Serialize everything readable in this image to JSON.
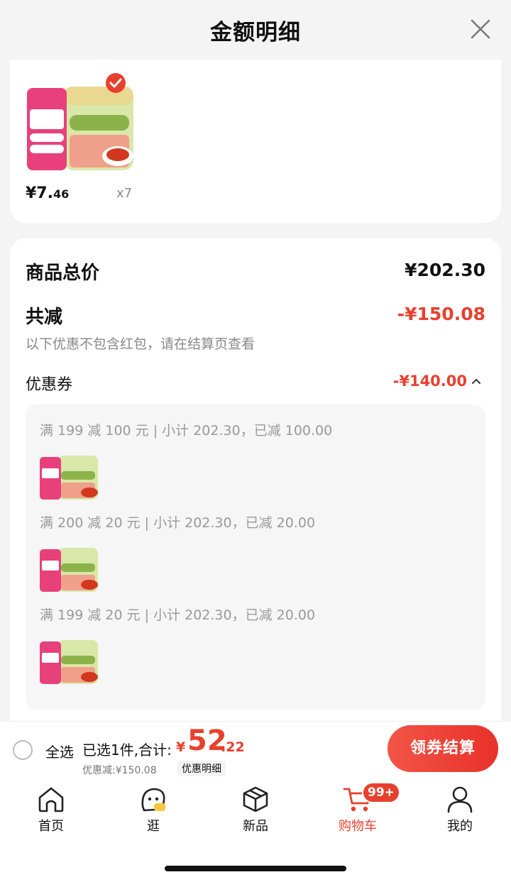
{
  "header": {
    "title": "金额明细"
  },
  "product": {
    "price_int": "¥7.",
    "price_dec": "46",
    "quantity": "x7"
  },
  "summary": {
    "total_label": "商品总价",
    "total_value": "¥202.30",
    "reduce_label": "共减",
    "reduce_value": "-¥150.08",
    "note": "以下优惠不包含红包，请在结算页查看",
    "coupon_label": "优惠券",
    "coupon_value": "-¥140.00",
    "coupons": [
      {
        "text": "满 199 减 100 元 | 小计 202.30，已减 100.00"
      },
      {
        "text": "满 200 减 20 元 | 小计 202.30，已减 20.00"
      },
      {
        "text": "满 199 减 20 元 | 小计 202.30，已减 20.00"
      }
    ]
  },
  "bottom_bar": {
    "select_all": "全选",
    "selected_text": "已选1件,合计:",
    "currency": "¥",
    "pay_int": "52",
    "pay_dec": ".22",
    "discount_text": "优惠减:¥150.08",
    "detail_chip": "优惠明细",
    "checkout": "领券结算"
  },
  "tabs": [
    {
      "label": "首页",
      "icon": "home-icon"
    },
    {
      "label": "逛",
      "icon": "explore-icon"
    },
    {
      "label": "新品",
      "icon": "box-icon"
    },
    {
      "label": "购物车",
      "icon": "cart-icon",
      "active": true
    },
    {
      "label": "我的",
      "icon": "person-icon"
    }
  ],
  "cart_badge": "99+",
  "colors": {
    "accent": "#e8402e",
    "muted": "#999999"
  }
}
